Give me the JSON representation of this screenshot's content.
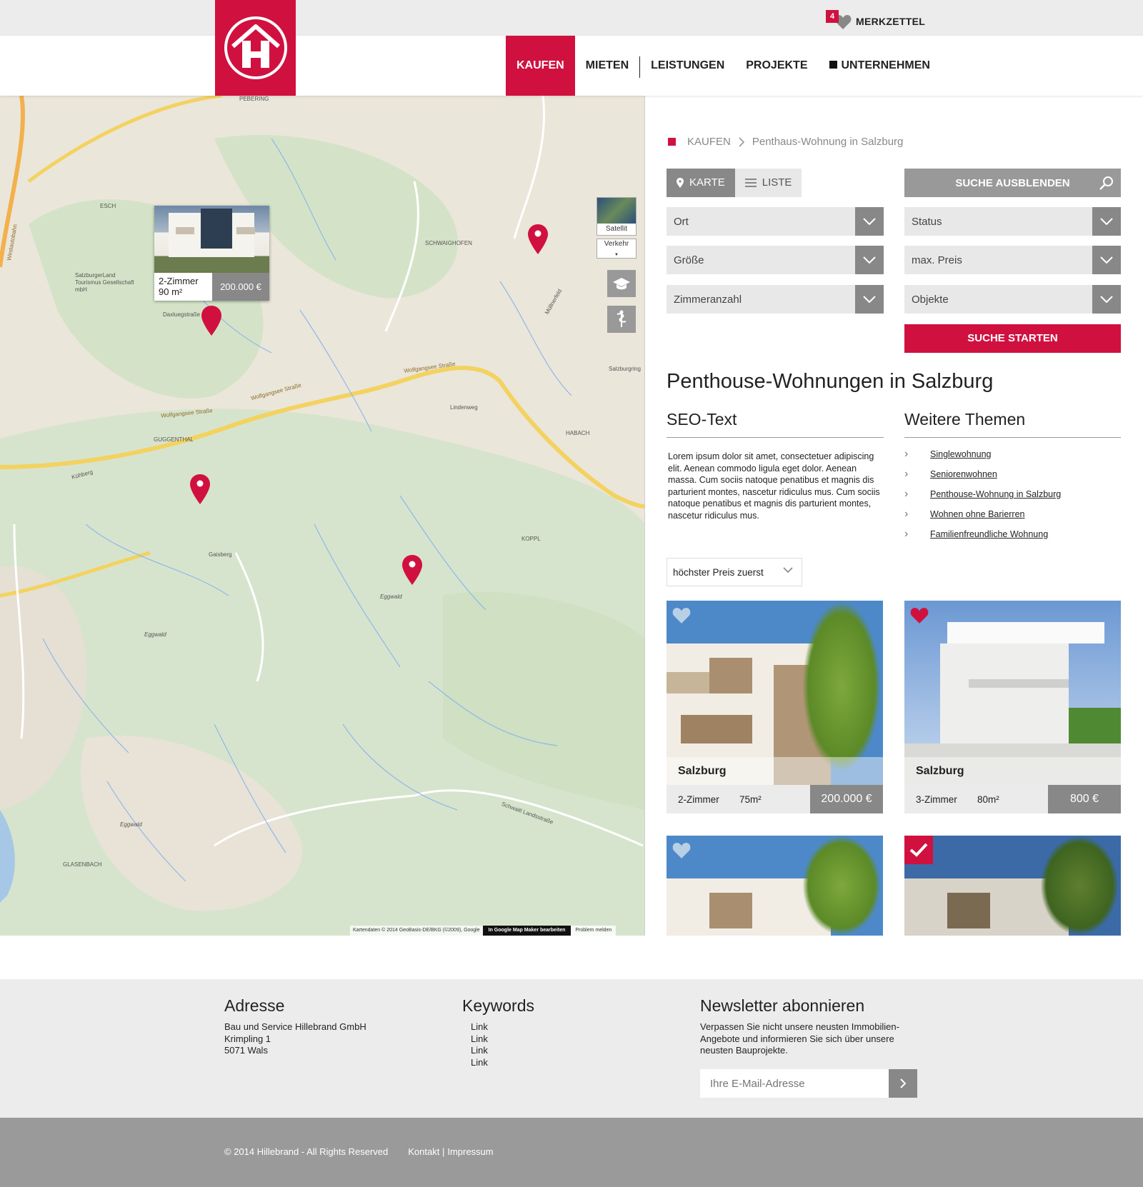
{
  "header": {
    "merkzettel_count": "4",
    "merkzettel_label": "MERKZETTEL",
    "nav": [
      "KAUFEN",
      "MIETEN",
      "LEISTUNGEN",
      "PROJEKTE",
      "UNTERNEHMEN"
    ],
    "brand_color": "#d0113f"
  },
  "map": {
    "controls": {
      "satellite": "Satellit",
      "traffic": "Verkehr"
    },
    "labels": {
      "westautobahn": "Westautobahn",
      "esch": "ESCH",
      "pebering": "PEBERING",
      "salzburgerland": "SalzburgerLand Tourismus Gesellschaft mbH",
      "schwaighofen": "SCHWAIGHOFEN",
      "wolfgangsee1": "Wolfgangsee Straße",
      "wolfgangsee2": "Wolfgangsee Straße",
      "wolfgangsee3": "Wolfgangsee Straße",
      "guggenthal": "GUGGENTHAL",
      "habach": "HABACH",
      "gaisberg": "Gaisberg",
      "eggwald1": "Eggwald",
      "eggwald2": "Eggwald",
      "eggwald3": "Eggwald",
      "koppl": "KOPPL",
      "salzburgring": "Salzburgring",
      "muellnerfeld": "Müllnerfeld",
      "glasenbach": "GLASENBACH",
      "schwaitl": "Schwaitl Landsstraße",
      "lindenweg": "Lindenweg",
      "daxluegstrasse": "Daxluegstraße",
      "kuehberg": "Kühberg"
    },
    "popup": {
      "rooms": "2-Zimmer",
      "size": "90 m²",
      "price": "200.000 €"
    },
    "attribution": {
      "data": "Kartendaten © 2014 GeoBasis-DE/BKG (©2009), Google",
      "mapmaker": "In Google Map Maker bearbeiten",
      "report": "Problem melden"
    }
  },
  "breadcrumb": {
    "root": "KAUFEN",
    "current": "Penthaus-Wohnung in Salzburg"
  },
  "view_toggle": {
    "map": "KARTE",
    "list": "LISTE"
  },
  "search": {
    "hide_label": "SUCHE AUSBLENDEN",
    "start_label": "SUCHE STARTEN",
    "filters_left": [
      "Ort",
      "Größe",
      "Zimmeranzahl"
    ],
    "filters_right": [
      "Status",
      "max. Preis",
      "Objekte"
    ]
  },
  "content": {
    "title": "Penthouse-Wohnungen in Salzburg",
    "seo_heading": "SEO-Text",
    "seo_text": "Lorem ipsum dolor sit amet, consectetuer adipiscing elit. Aenean commodo ligula eget dolor. Aenean massa. Cum sociis natoque penatibus et magnis dis parturient montes, nascetur ridiculus mus. Cum sociis natoque penatibus et magnis dis parturient montes, nascetur ridiculus mus.",
    "topics_heading": "Weitere Themen",
    "topics": [
      "Singlewohnung",
      "Seniorenwohnen",
      "Penthouse-Wohnung in Salzburg",
      "Wohnen ohne Barierren",
      "Familienfreundliche Wohnung"
    ]
  },
  "sort": {
    "selected": "höchster Preis zuerst"
  },
  "listings": [
    {
      "city": "Salzburg",
      "rooms": "2-Zimmer",
      "size": "75m²",
      "price": "200.000 €",
      "favorite": false
    },
    {
      "city": "Salzburg",
      "rooms": "3-Zimmer",
      "size": "80m²",
      "price": "800 €",
      "favorite": true
    }
  ],
  "footer": {
    "address_heading": "Adresse",
    "address_lines": [
      "Bau und Service Hillebrand GmbH",
      "Krimpling 1",
      "5071 Wals"
    ],
    "keywords_heading": "Keywords",
    "keywords": [
      "Link",
      "Link",
      "Link",
      "Link"
    ],
    "newsletter_heading": "Newsletter abonnieren",
    "newsletter_text": "Verpassen Sie nicht unsere neusten Immobilien-Angebote und informieren Sie sich über unsere neusten Bauprojekte.",
    "email_placeholder": "Ihre E-Mail-Adresse",
    "copyright": "© 2014 Hillebrand - All Rights Reserved",
    "contact": "Kontakt |",
    "imprint": "Impressum"
  }
}
